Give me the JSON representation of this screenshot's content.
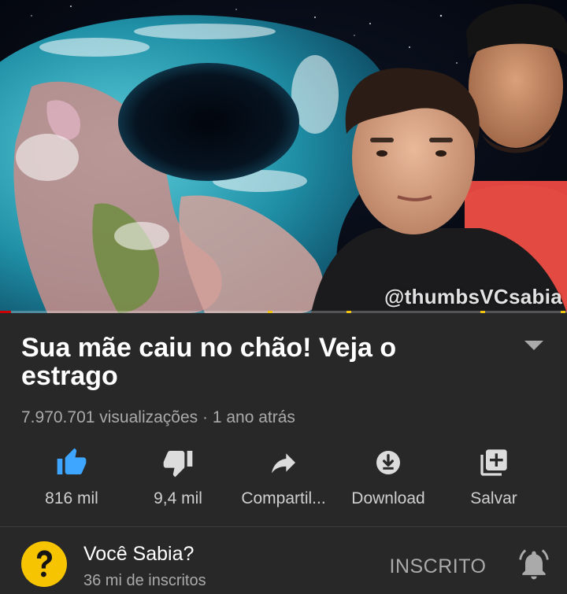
{
  "video": {
    "watermark": "@thumbsVCsabia",
    "progress_fraction": 0.02,
    "title": "Sua mãe caiu no chão! Veja o estrago",
    "views": "7.970.701 visualizações",
    "separator": "·",
    "age": "1 ano atrás"
  },
  "actions": [
    {
      "label": "816 mil",
      "icon": "thumbs-up-icon",
      "active": true
    },
    {
      "label": "9,4 mil",
      "icon": "thumbs-down-icon",
      "active": false
    },
    {
      "label": "Compartil...",
      "icon": "share-icon",
      "active": false
    },
    {
      "label": "Download",
      "icon": "download-icon",
      "active": false
    },
    {
      "label": "Salvar",
      "icon": "save-playlist-icon",
      "active": false
    }
  ],
  "channel": {
    "name": "Você Sabia?",
    "subscribers": "36 mi de inscritos",
    "subscribe_state": "INSCRITO",
    "avatar_icon": "question-mark-avatar",
    "bell_icon": "bell-icon"
  },
  "colors": {
    "background": "#282828",
    "like_active": "#3ea6ff",
    "secondary_text": "#aaaaaa",
    "avatar_yellow": "#f6c400",
    "progress": "#cc0000"
  }
}
